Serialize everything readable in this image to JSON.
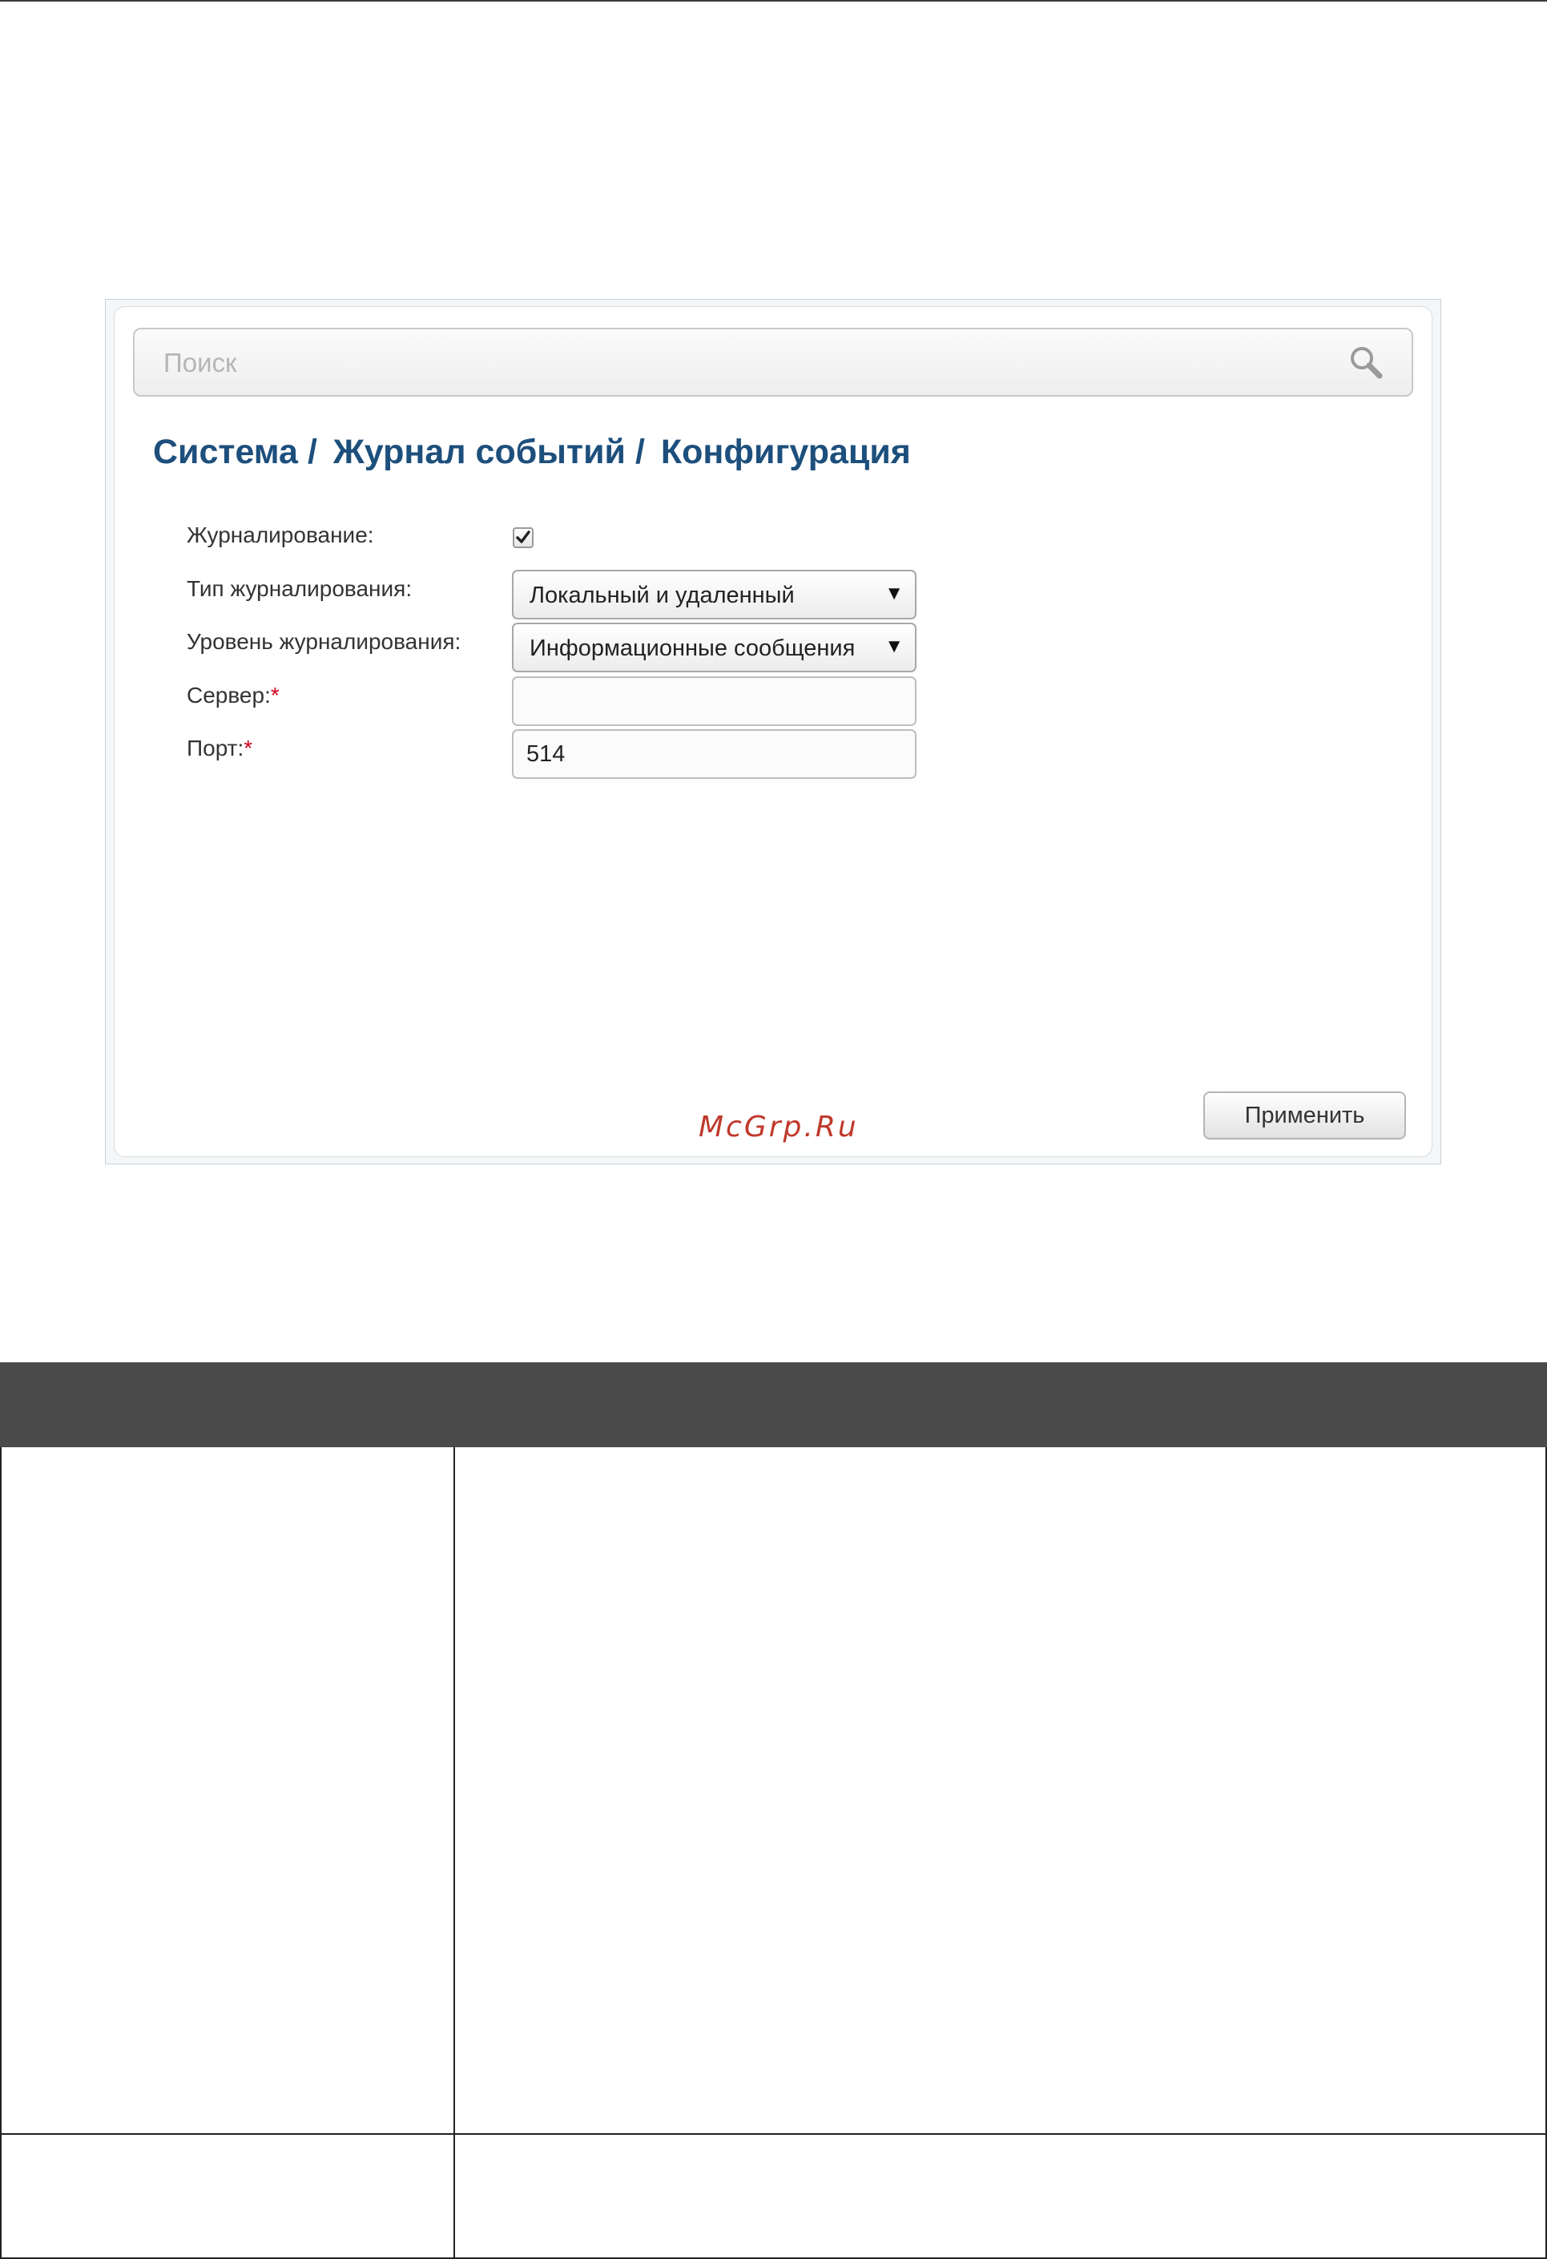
{
  "search": {
    "placeholder": "Поиск",
    "value": ""
  },
  "breadcrumb": {
    "items": [
      "Система",
      "Журнал событий",
      "Конфигурация"
    ],
    "separator": "/"
  },
  "form": {
    "logging": {
      "label": "Журналирование:",
      "checked": true
    },
    "log_type": {
      "label": "Тип журналирования:",
      "value": "Локальный и удаленный"
    },
    "log_level": {
      "label": "Уровень журналирования:",
      "value": "Информационные сообщения"
    },
    "server": {
      "label": "Сервер:",
      "required_mark": "*",
      "value": ""
    },
    "port": {
      "label": "Порт:",
      "required_mark": "*",
      "value": "514"
    }
  },
  "actions": {
    "apply_label": "Применить"
  },
  "watermark": "McGrp.Ru",
  "colors": {
    "breadcrumb": "#1d4f7c",
    "required": "#d0021b",
    "table_header": "#4a4a4a"
  }
}
